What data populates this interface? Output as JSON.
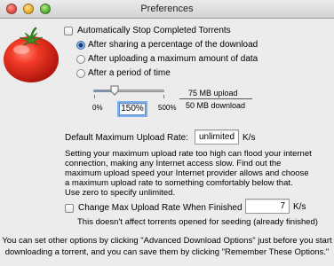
{
  "window": {
    "title": "Preferences"
  },
  "options": {
    "auto_stop_label": "Automatically Stop Completed Torrents",
    "radio_percentage_label": "After sharing a percentage of the download",
    "radio_upload_label": "After uploading a maximum amount of data",
    "radio_time_label": "After a period of time",
    "selected_radio": "percentage"
  },
  "slider": {
    "min_label": "0%",
    "mid_label": "150%",
    "max_label": "500%",
    "value_percent": 150,
    "min_percent": 0,
    "max_percent": 500,
    "upload_amount": "75 MB upload",
    "download_amount": "50 MB download"
  },
  "upload_rate": {
    "label": "Default Maximum Upload Rate:",
    "value": "unlimited",
    "unit": "K/s",
    "note": "Setting your maximum upload rate too high can flood your internet connection, making any Internet access slow. Find out the maximum upload speed your Internet provider allows and choose a maximum upload rate to something comfortably below that.\nUse zero to specify unlimited."
  },
  "finished_rate": {
    "label": "Change Max Upload Rate When Finished",
    "value": "7",
    "unit": "K/s",
    "note": "This doesn't affect torrents opened for seeding (already finished)"
  },
  "footer": {
    "line1": "You can set other options by clicking \"Advanced Download Options\" just before you start",
    "line2": "downloading a torrent, and you can save them by clicking \"Remember These Options.\""
  },
  "colors": {
    "accent": "#5b8fd1",
    "tomato": "#e0261a",
    "window_bg": "#ececec"
  }
}
